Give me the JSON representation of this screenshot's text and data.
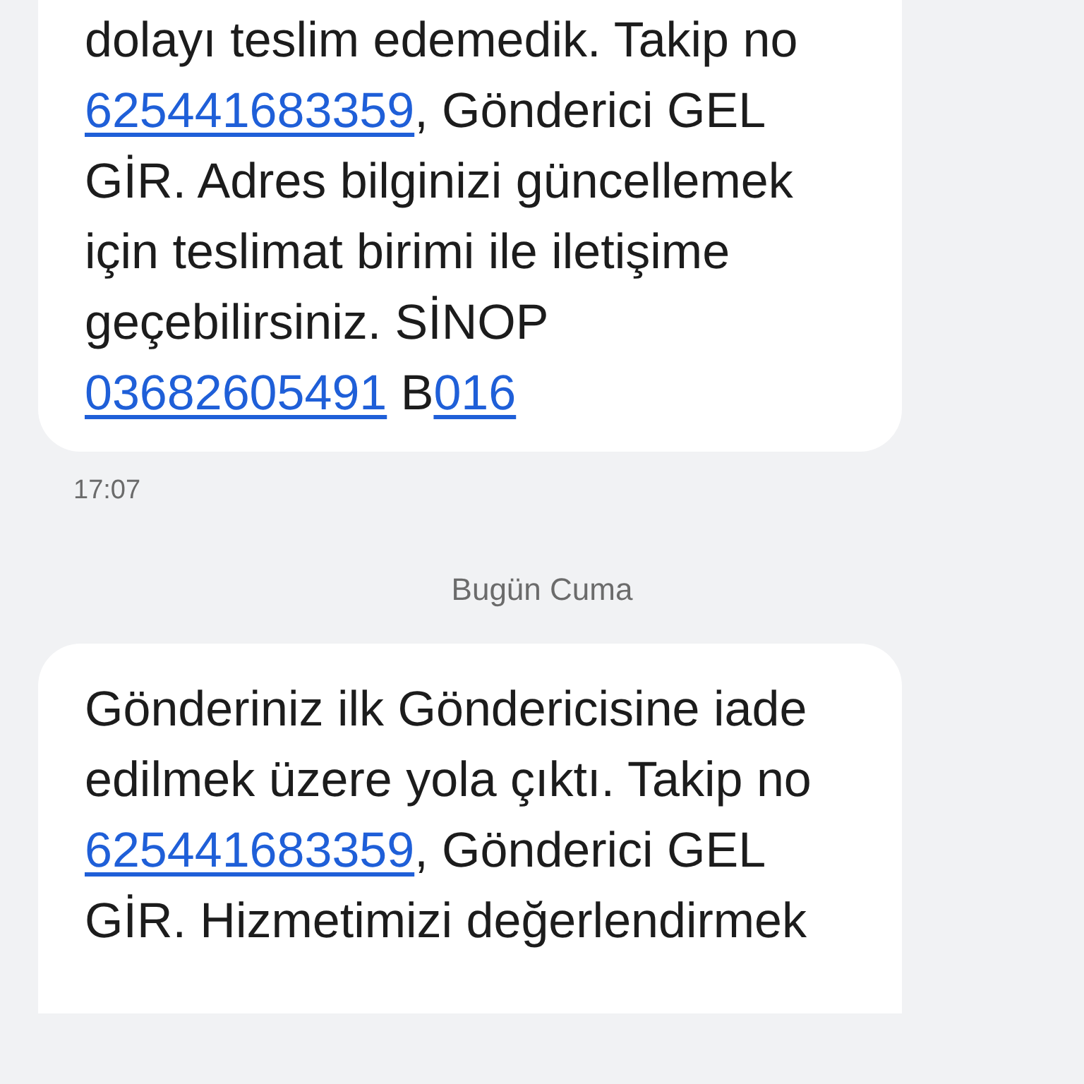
{
  "messages": [
    {
      "segments": [
        {
          "text": "dolayı teslim edemedik. Takip no ",
          "link": false
        },
        {
          "text": "625441683359",
          "link": true
        },
        {
          "text": ", Gönderici GEL GİR. Adres bilginizi güncellemek için teslimat birimi ile iletişime geçebilirsiniz. SİNOP ",
          "link": false
        },
        {
          "text": "03682605491",
          "link": true
        },
        {
          "text": " B",
          "link": false
        },
        {
          "text": "016",
          "link": true
        }
      ],
      "time": "17:07"
    },
    {
      "date": "Bugün Cuma"
    },
    {
      "segments": [
        {
          "text": "Gönderiniz ilk Göndericisine iade edilmek üzere yola çıktı. Takip no ",
          "link": false
        },
        {
          "text": "625441683359",
          "link": true
        },
        {
          "text": ", Gönderici GEL GİR. Hizmetimizi değerlendirmek",
          "link": false
        }
      ]
    }
  ]
}
